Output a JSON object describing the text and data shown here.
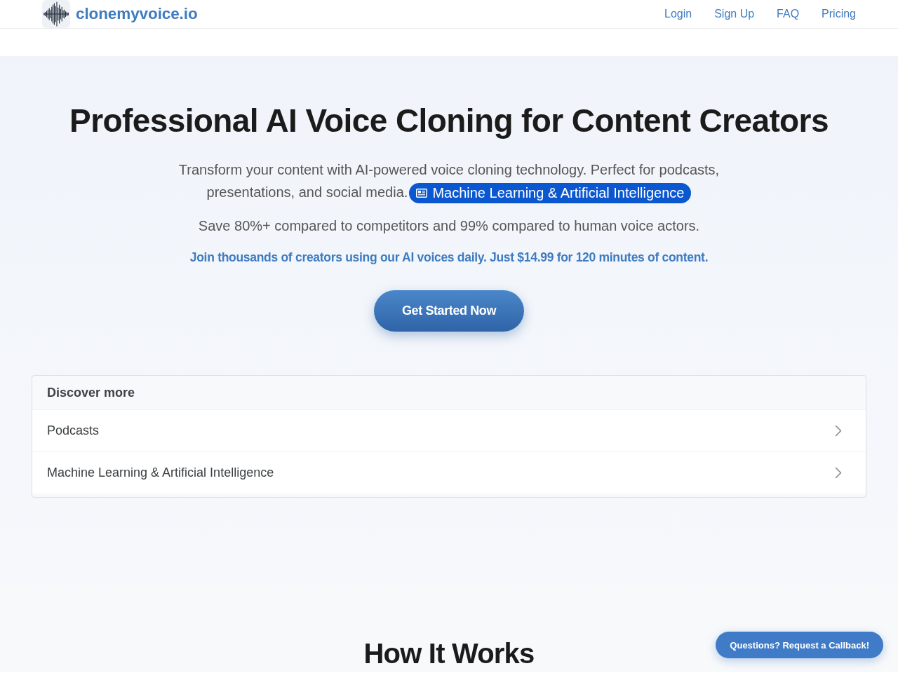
{
  "header": {
    "brand": "clonemyvoice.io",
    "nav_links": [
      "Login",
      "Sign Up",
      "FAQ",
      "Pricing"
    ]
  },
  "hero": {
    "title": "Professional AI Voice Cloning for Content Creators",
    "intro": "Transform your content with AI-powered voice cloning technology. Perfect for podcasts, presentations, and social media.",
    "intro_link": "Machine Learning & Artificial Intelligence",
    "savings": "Save 80%+ compared to competitors and 99% compared to human voice actors.",
    "offer": "Join thousands of creators using our AI voices daily. Just $14.99 for 120 minutes of content.",
    "cta": "Get Started Now"
  },
  "discover_more": {
    "title": "Discover more",
    "items": [
      "Podcasts",
      "Machine Learning & Artificial Intelligence"
    ]
  },
  "how_it_works": {
    "title": "How It Works"
  },
  "callback_button": "Questions? Request a Callback!"
}
